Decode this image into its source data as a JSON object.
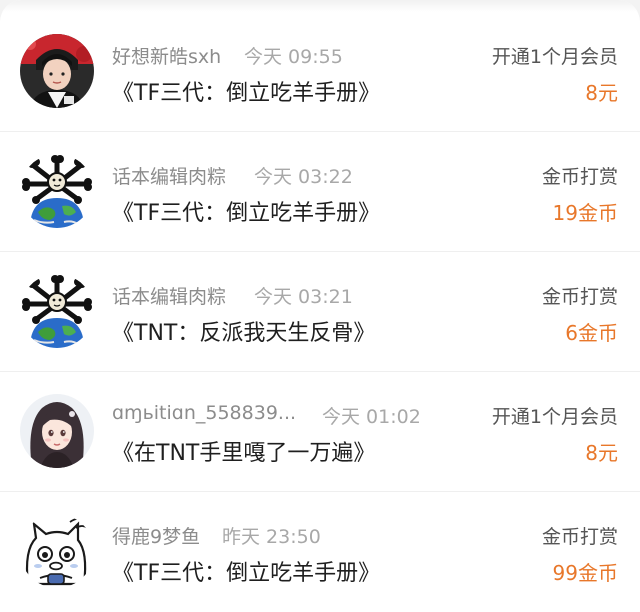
{
  "records": [
    {
      "avatar_icon": "user-photo-avatar",
      "name": "好想新皓sxh",
      "time": "今天 09:55",
      "title": "《TF三代：倒立吃羊手册》",
      "type": "开通1个月会员",
      "amount": "8元"
    },
    {
      "avatar_icon": "globe-creature-avatar",
      "name": "话本编辑肉粽",
      "time": "今天 03:22",
      "title": "《TF三代：倒立吃羊手册》",
      "type": "金币打赏",
      "amount": "19金币"
    },
    {
      "avatar_icon": "globe-creature-avatar",
      "name": "话本编辑肉粽",
      "time": "今天 03:21",
      "title": "《TNT：反派我天生反骨》",
      "type": "金币打赏",
      "amount": "6金币"
    },
    {
      "avatar_icon": "illustrated-girl-avatar",
      "name": "ɑɱьitiɑn_558839...",
      "time": "今天 01:02",
      "title": "《在TNT手里嘎了一万遍》",
      "type": "开通1个月会员",
      "amount": "8元"
    },
    {
      "avatar_icon": "cartoon-cat-avatar",
      "name": "得鹿9梦鱼",
      "time": "昨天 23:50",
      "title": "《TF三代：倒立吃羊手册》",
      "type": "金币打赏",
      "amount": "99金币"
    }
  ],
  "colors": {
    "amount": "#e8772a",
    "name": "#8c8c8c",
    "time": "#a8a8a8",
    "title": "#1f1f1f",
    "type": "#555555"
  }
}
